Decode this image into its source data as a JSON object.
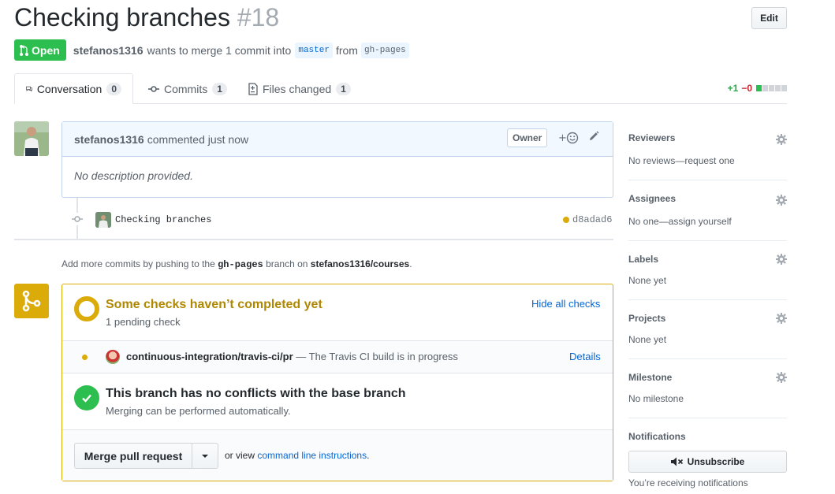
{
  "pr": {
    "title": "Checking branches",
    "number": "#18",
    "edit_label": "Edit",
    "state": "Open",
    "author": "stefanos1316",
    "summary": "wants to merge 1 commit into",
    "base_branch": "master",
    "from_label": "from",
    "head_branch": "gh-pages"
  },
  "tabs": [
    {
      "label": "Conversation",
      "count": "0"
    },
    {
      "label": "Commits",
      "count": "1"
    },
    {
      "label": "Files changed",
      "count": "1"
    }
  ],
  "diffstat": {
    "additions": "+1",
    "deletions": "−0",
    "blocks_added": 1,
    "blocks_total": 5
  },
  "comment": {
    "author": "stefanos1316",
    "time": "commented just now",
    "badge": "Owner",
    "reaction_icon": "smiley-icon",
    "body": "No description provided."
  },
  "commit": {
    "message": "Checking branches",
    "sha": "d8adad6",
    "status_color": "#dbab09"
  },
  "push_hint": {
    "prefix": "Add more commits by pushing to the",
    "branch": "gh-pages",
    "middle": "branch on",
    "repo": "stefanos1316/courses",
    "suffix": "."
  },
  "checks": {
    "title": "Some checks haven’t completed yet",
    "subtitle": "1 pending check",
    "toggle_label": "Hide all checks",
    "items": [
      {
        "context": "continuous-integration/travis-ci/pr",
        "description": "— The Travis CI build is in progress",
        "details_label": "Details"
      }
    ]
  },
  "conflicts": {
    "title": "This branch has no conflicts with the base branch",
    "subtitle": "Merging can be performed automatically."
  },
  "merge": {
    "button_label": "Merge pull request",
    "hint_prefix": "or view",
    "hint_link": "command line instructions",
    "hint_suffix": "."
  },
  "sidebar": {
    "reviewers": {
      "title": "Reviewers",
      "value": "No reviews—request one"
    },
    "assignees": {
      "title": "Assignees",
      "value": "No one—assign yourself"
    },
    "labels": {
      "title": "Labels",
      "value": "None yet"
    },
    "projects": {
      "title": "Projects",
      "value": "None yet"
    },
    "milestone": {
      "title": "Milestone",
      "value": "No milestone"
    },
    "notifications": {
      "title": "Notifications",
      "button_label": "Unsubscribe",
      "note": "You’re receiving notifications"
    }
  },
  "colors": {
    "open": "#2cbe4e",
    "pending": "#dbab09",
    "link": "#0366d6"
  }
}
